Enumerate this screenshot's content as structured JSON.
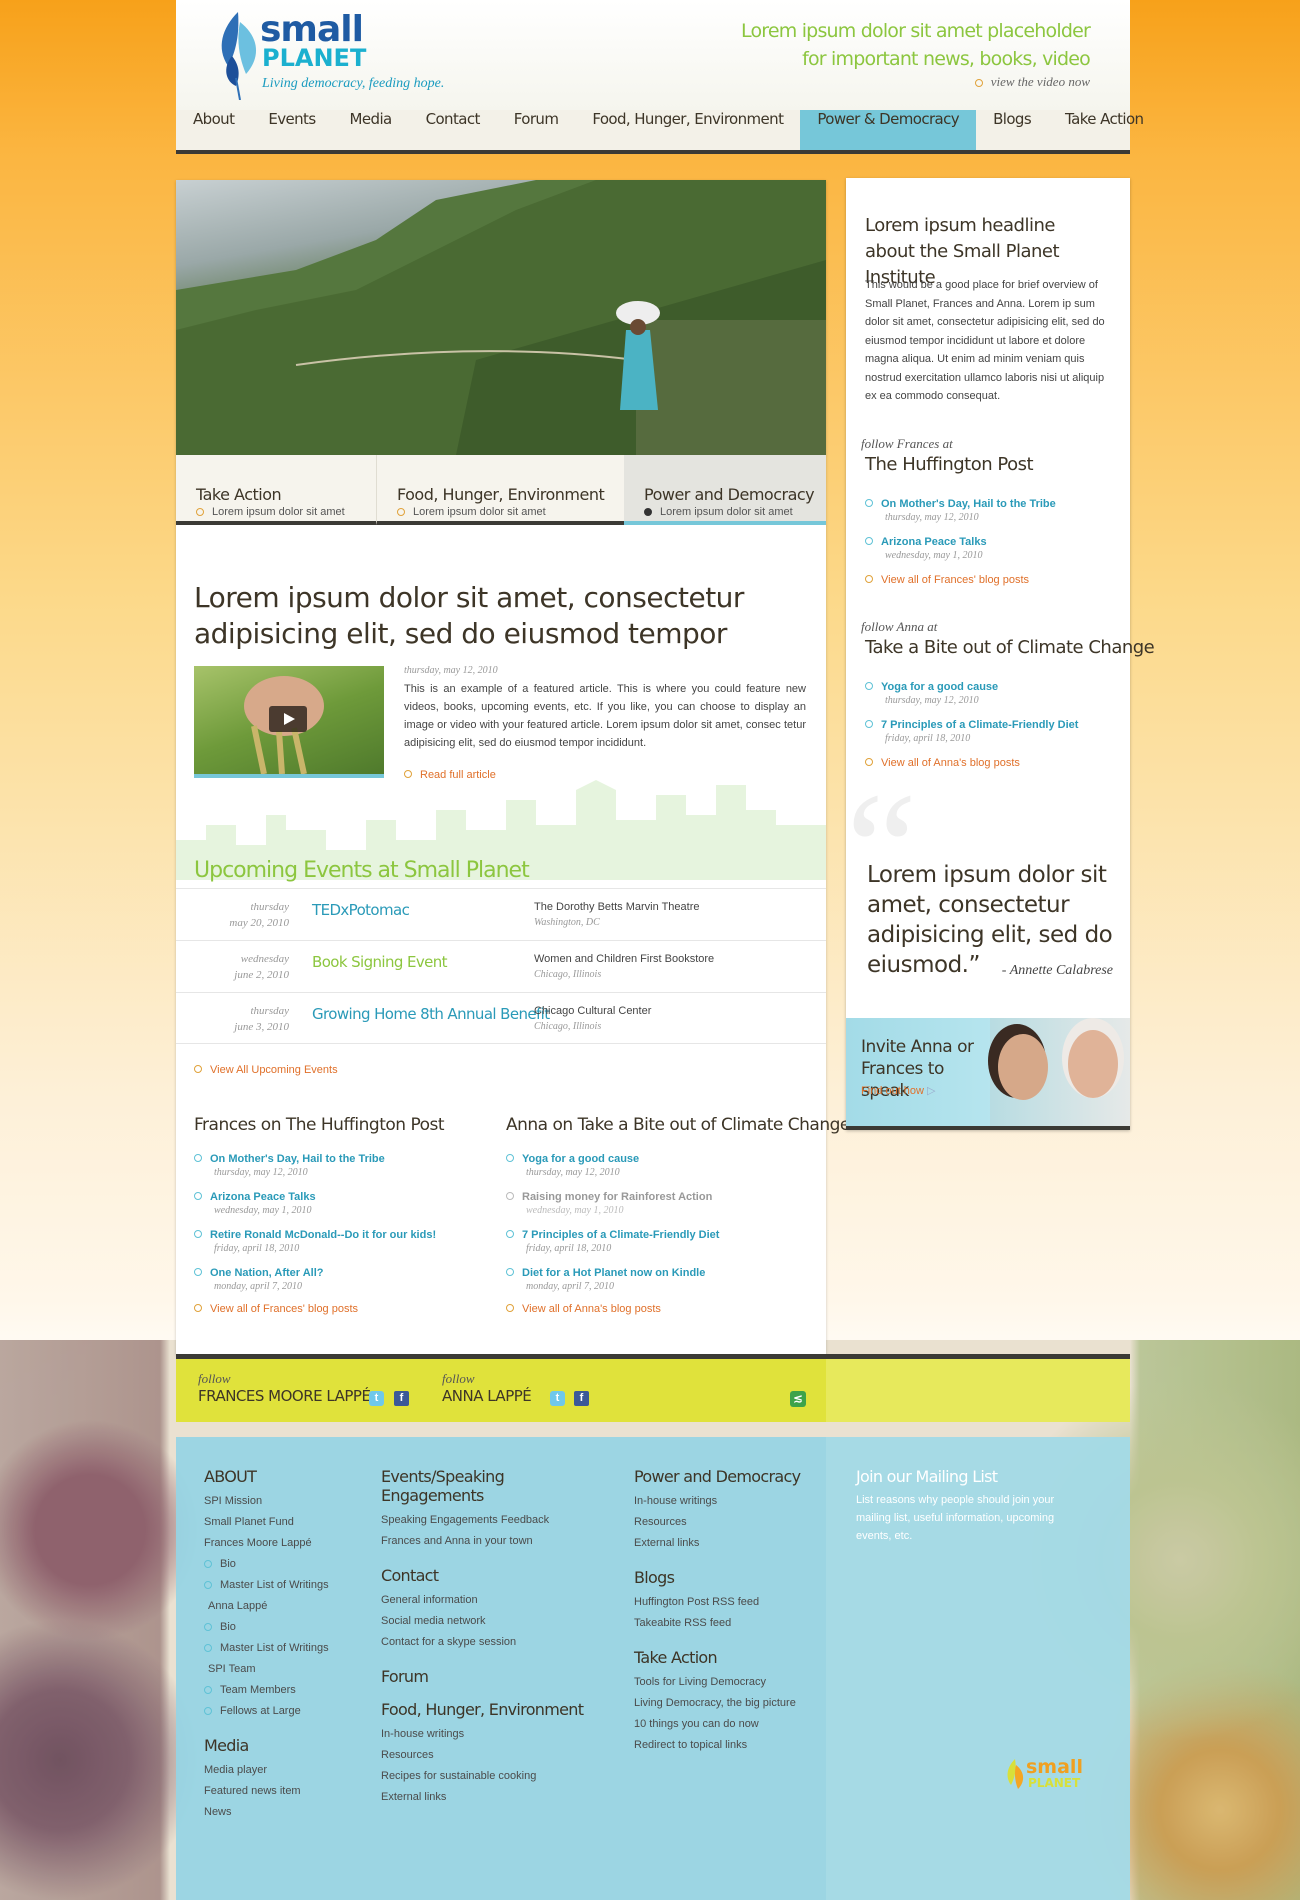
{
  "brand": {
    "name_top": "small",
    "name_bottom": "PLANET",
    "tagline": "Living democracy, feeding hope."
  },
  "promo": {
    "line1": "Lorem ipsum dolor sit amet placeholder",
    "line2": "for important news, books, video",
    "link": "view the video now"
  },
  "nav": [
    "About",
    "Events",
    "Media",
    "Contact",
    "Forum",
    "Food, Hunger, Environment",
    "Power & Democracy",
    "Blogs",
    "Take Action"
  ],
  "nav_active": "Power & Democracy",
  "hero_tabs": [
    {
      "title": "Take Action",
      "sub": "Lorem ipsum dolor sit amet"
    },
    {
      "title": "Food, Hunger, Environment",
      "sub": "Lorem ipsum dolor sit amet"
    },
    {
      "title": "Power and Democracy",
      "sub": "Lorem ipsum dolor sit amet"
    }
  ],
  "feature": {
    "headline": "Lorem ipsum dolor sit amet, consectetur adipisicing elit, sed do eiusmod tempor",
    "date": "thursday, may 12, 2010",
    "body": "This is an example of a featured article. This is where you could feature new videos, books, upcoming events, etc. If you like, you can choose to display an image or video with your featured article. Lorem ipsum dolor sit amet, consec tetur adipisicing elit, sed do eiusmod tempor incididunt.",
    "read_more": "Read full article"
  },
  "events": {
    "title": "Upcoming Events at Small Planet",
    "view_all": "View All Upcoming Events",
    "items": [
      {
        "day": "thursday",
        "date": "may 20, 2010",
        "name": "TEDxPotomac",
        "venue": "The Dorothy Betts Marvin Theatre",
        "city": "Washington, DC"
      },
      {
        "day": "wednesday",
        "date": "june 2, 2010",
        "name": "Book Signing Event",
        "venue": "Women and Children First Bookstore",
        "city": "Chicago, Illinois"
      },
      {
        "day": "thursday",
        "date": "june 3, 2010",
        "name": "Growing Home 8th Annual Benefit",
        "venue": "Chicago Cultural Center",
        "city": "Chicago, Illinois"
      }
    ]
  },
  "blog_frances": {
    "title": "Frances on The Huffington Post",
    "view_all": "View all of Frances' blog posts",
    "posts": [
      {
        "title": "On Mother's Day, Hail to the Tribe",
        "date": "thursday, may 12, 2010"
      },
      {
        "title": "Arizona Peace Talks",
        "date": "wednesday, may 1, 2010"
      },
      {
        "title": "Retire Ronald McDonald--Do it for our kids!",
        "date": "friday, april 18, 2010"
      },
      {
        "title": "One Nation, After All?",
        "date": "monday, april 7, 2010"
      }
    ]
  },
  "blog_anna": {
    "title": "Anna on Take a Bite out of Climate Change",
    "view_all": "View all of Anna's blog posts",
    "posts": [
      {
        "title": "Yoga for a good cause",
        "date": "thursday, may 12, 2010"
      },
      {
        "title": "Raising money for Rainforest Action",
        "date": "wednesday, may 1, 2010"
      },
      {
        "title": "7 Principles of a Climate-Friendly Diet",
        "date": "friday, april 18, 2010"
      },
      {
        "title": "Diet for a Hot Planet now on Kindle",
        "date": "monday, april 7, 2010"
      }
    ]
  },
  "sidebar": {
    "about_title": "Lorem ipsum headline about the Small Planet Institute",
    "about_body": "This would be a good place for brief overview of Small Planet, Frances and Anna. Lorem ip sum dolor sit amet, consectetur adipisicing elit, sed do eiusmod tempor incididunt ut labore et dolore magna aliqua. Ut enim ad minim veniam quis nostrud exercitation ullamco laboris nisi ut aliquip ex ea commodo consequat.",
    "follow_label": "follow",
    "f_who": "Frances at",
    "f_title": "The Huffington Post",
    "f_posts": [
      {
        "title": "On Mother's Day, Hail to the Tribe",
        "date": "thursday, may 12, 2010"
      },
      {
        "title": "Arizona Peace Talks",
        "date": "wednesday, may 1, 2010"
      }
    ],
    "f_all": "View all of Frances' blog posts",
    "a_who": "Anna at",
    "a_title": "Take a Bite out of Climate Change",
    "a_posts": [
      {
        "title": "Yoga for a good cause",
        "date": "thursday, may 12, 2010"
      },
      {
        "title": "7 Principles of a Climate-Friendly Diet",
        "date": "friday, april 18, 2010"
      }
    ],
    "a_all": "View all of Anna's blog posts",
    "quote": "Lorem ipsum dolor sit amet, consectetur adipisicing elit, sed do eiusmod.”",
    "quote_by": "- Annette Calabrese",
    "invite_title": "Invite Anna or Frances to speak",
    "invite_link": "Find out how"
  },
  "follow_bar": {
    "label": "follow",
    "p1": "FRANCES MOORE LAPPÉ",
    "p2": "ANNA LAPPÉ"
  },
  "footer": {
    "c1": {
      "h": "ABOUT",
      "items": [
        "SPI Mission",
        "Small Planet Fund",
        "Frances Moore Lappé"
      ],
      "sub1": [
        "Bio",
        "Master List of Writings"
      ],
      "mid": "Anna Lappé",
      "sub2": [
        "Bio",
        "Master List of Writings"
      ],
      "mid2": "SPI Team",
      "sub3": [
        "Team Members",
        "Fellows at Large"
      ],
      "h2": "Media",
      "items2": [
        "Media player",
        "Featured news item",
        "News"
      ]
    },
    "c2": {
      "h1": "Events/Speaking Engagements",
      "i1": [
        "Speaking Engagements Feedback",
        "Frances and Anna in your town"
      ],
      "h2": "Contact",
      "i2": [
        "General information",
        "Social media network",
        "Contact for a skype session"
      ],
      "h3": "Forum",
      "h4": "Food, Hunger, Environment",
      "i4": [
        "In-house writings",
        "Resources",
        "Recipes for sustainable cooking",
        "External links"
      ]
    },
    "c3": {
      "h1": "Power and Democracy",
      "i1": [
        "In-house writings",
        "Resources",
        "External links"
      ],
      "h2": "Blogs",
      "i2": [
        "Huffington Post RSS feed",
        "Takeabite RSS feed"
      ],
      "h3": "Take Action",
      "i3": [
        "Tools for Living Democracy",
        "Living Democracy, the big picture",
        "10 things you can do now",
        "Redirect to topical links"
      ]
    },
    "c4": {
      "h": "Join our Mailing List",
      "body": "List reasons why people should join your mailing list, useful information, upcoming events, etc."
    },
    "logo_top": "small",
    "logo_bottom": "PLANET"
  }
}
